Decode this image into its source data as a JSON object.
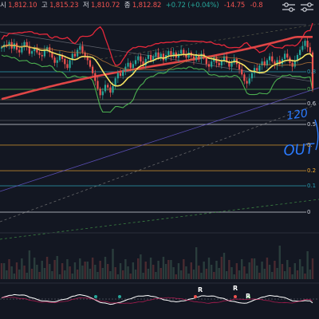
{
  "ohlc_header": {
    "open_label": "시",
    "open_value": "1,812.10",
    "high_label": "고",
    "high_value": "1,815.23",
    "low_label": "저",
    "low_value": "1,810.72",
    "close_label": "종",
    "close_value": "1,812.82",
    "change": "+0.72 (+0.04%)",
    "second_change": "-14.75",
    "second_extra": "-0.8"
  },
  "colors": {
    "background": "#131722",
    "bull": "#26a69a",
    "bear": "#ef5350",
    "bollinger": "#e5283b",
    "ma_yellow": "#f7e463",
    "ma_red": "#e04646",
    "lower_band_green": "#4caf50",
    "fib": "#2aa0b4",
    "fib_orange": "#f0a830",
    "annotation_blue": "#2b7bff"
  },
  "chart_data": {
    "type": "candlestick",
    "title": "",
    "xlabel": "",
    "ylabel": "",
    "fib_levels": [
      {
        "label": "0.8",
        "value": 0.8,
        "color": "#2aa0b4"
      },
      {
        "label": "0.",
        "value": 0.7,
        "color": "#4caf50"
      },
      {
        "label": "0.6",
        "value": 0.618,
        "color": "#d1d4dc"
      },
      {
        "label": "0.5",
        "value": 0.5,
        "color": "#d1d4dc"
      },
      {
        "label": "0.",
        "value": 0.382,
        "color": "#f0a830"
      },
      {
        "label": "0.2",
        "value": 0.236,
        "color": "#f0a830"
      },
      {
        "label": "0.1",
        "value": 0.15,
        "color": "#2aa0b4"
      },
      {
        "label": "0",
        "value": 0,
        "color": "#d1d4dc"
      }
    ],
    "series_closes": [
      62,
      64,
      63,
      66,
      61,
      65,
      60,
      58,
      62,
      66,
      63,
      57,
      59,
      61,
      58,
      56,
      55,
      60,
      62,
      58,
      54,
      50,
      52,
      56,
      53,
      49,
      46,
      52,
      57,
      55,
      60,
      63,
      58,
      55,
      52,
      47,
      42,
      36,
      30,
      25,
      28,
      33,
      31,
      27,
      32,
      38,
      42,
      40,
      44,
      47,
      50,
      46,
      49,
      52,
      55,
      51,
      48,
      53,
      56,
      52,
      55,
      58,
      54,
      57,
      52,
      56,
      59,
      55,
      58,
      54,
      57,
      60,
      57,
      54,
      58,
      55,
      52,
      56,
      53,
      57,
      54,
      49,
      47,
      51,
      54,
      50,
      48,
      52,
      55,
      51,
      47,
      50,
      53,
      49,
      45,
      41,
      36,
      34,
      38,
      42,
      46,
      44,
      48,
      51,
      48,
      52,
      55,
      51,
      48,
      52,
      49,
      53,
      57,
      54,
      50,
      47,
      52,
      56,
      60,
      63,
      67,
      62,
      58,
      30
    ],
    "annotation_text": "120",
    "annotation_text2": "OUT",
    "rsi_marks": [
      "R",
      "R",
      "R"
    ]
  }
}
